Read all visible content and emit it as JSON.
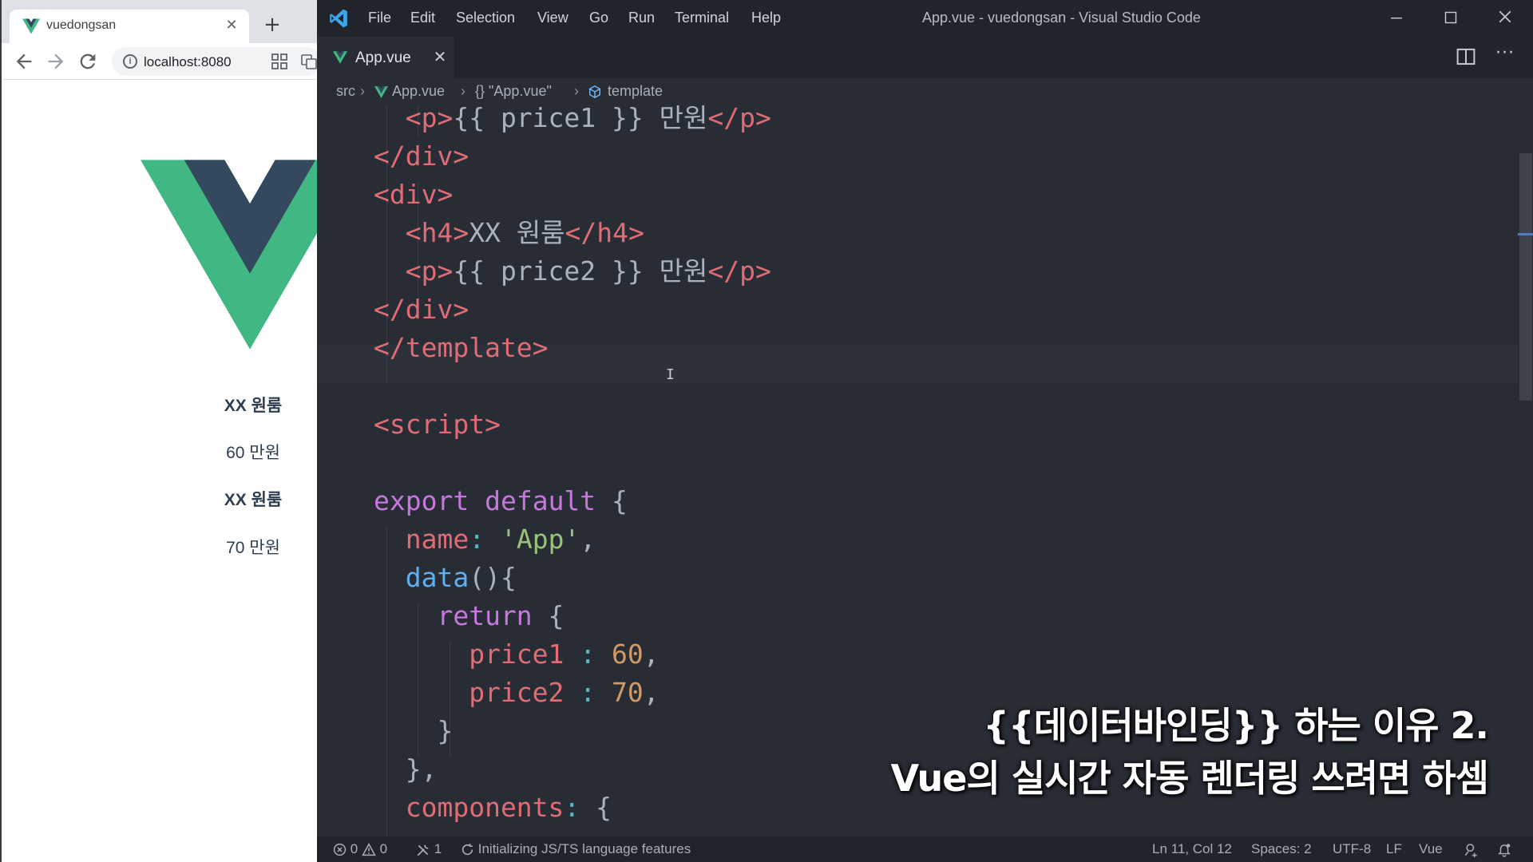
{
  "browser": {
    "tab_title": "vuedongsan",
    "tab_close": "✕",
    "new_tab": "+",
    "url": "localhost:8080",
    "page": {
      "products": [
        {
          "title": "XX 원룸",
          "price": "60 만원"
        },
        {
          "title": "XX 원룸",
          "price": "70 만원"
        }
      ]
    }
  },
  "vscode": {
    "menu": [
      "File",
      "Edit",
      "Selection",
      "View",
      "Go",
      "Run",
      "Terminal",
      "Help"
    ],
    "window_title": "App.vue - vuedongsan - Visual Studio Code",
    "tab": {
      "name": "App.vue",
      "close": "✕"
    },
    "breadcrumb": {
      "folder": "src",
      "file": "App.vue",
      "object": "{} \"App.vue\"",
      "symbol": "template"
    },
    "code_lines": [
      [
        {
          "t": "tag",
          "v": "  <p>"
        },
        {
          "t": "text",
          "v": "{{ price1 }} 만원"
        },
        {
          "t": "tag",
          "v": "</p>"
        }
      ],
      [
        {
          "t": "tag",
          "v": "</div>"
        }
      ],
      [
        {
          "t": "tag",
          "v": "<div>"
        }
      ],
      [
        {
          "t": "tag",
          "v": "  <h4>"
        },
        {
          "t": "text",
          "v": "XX 원룸"
        },
        {
          "t": "tag",
          "v": "</h4>"
        }
      ],
      [
        {
          "t": "tag",
          "v": "  <p>"
        },
        {
          "t": "text",
          "v": "{{ price2 }} 만원"
        },
        {
          "t": "tag",
          "v": "</p>"
        }
      ],
      [
        {
          "t": "tag",
          "v": "</div>"
        }
      ],
      [
        {
          "t": "tag",
          "v": "</template>"
        }
      ],
      [],
      [
        {
          "t": "tag",
          "v": "<script>"
        }
      ],
      [],
      [
        {
          "t": "kw",
          "v": "export"
        },
        {
          "t": "punc",
          "v": " "
        },
        {
          "t": "kw",
          "v": "default"
        },
        {
          "t": "punc",
          "v": " {"
        }
      ],
      [
        {
          "t": "prop",
          "v": "  name"
        },
        {
          "t": "op",
          "v": ":"
        },
        {
          "t": "punc",
          "v": " "
        },
        {
          "t": "str",
          "v": "'App'"
        },
        {
          "t": "punc",
          "v": ","
        }
      ],
      [
        {
          "t": "fn",
          "v": "  data"
        },
        {
          "t": "punc",
          "v": "(){"
        }
      ],
      [
        {
          "t": "kw",
          "v": "    return"
        },
        {
          "t": "punc",
          "v": " {"
        }
      ],
      [
        {
          "t": "prop",
          "v": "      price1"
        },
        {
          "t": "punc",
          "v": " "
        },
        {
          "t": "op",
          "v": ":"
        },
        {
          "t": "punc",
          "v": " "
        },
        {
          "t": "num",
          "v": "60"
        },
        {
          "t": "punc",
          "v": ","
        }
      ],
      [
        {
          "t": "prop",
          "v": "      price2"
        },
        {
          "t": "punc",
          "v": " "
        },
        {
          "t": "op",
          "v": ":"
        },
        {
          "t": "punc",
          "v": " "
        },
        {
          "t": "num",
          "v": "70"
        },
        {
          "t": "punc",
          "v": ","
        }
      ],
      [
        {
          "t": "punc",
          "v": "    }"
        }
      ],
      [
        {
          "t": "punc",
          "v": "  },"
        }
      ],
      [
        {
          "t": "prop",
          "v": "  components"
        },
        {
          "t": "op",
          "v": ":"
        },
        {
          "t": "punc",
          "v": " {"
        }
      ]
    ],
    "status": {
      "errors": "0",
      "warnings": "0",
      "ports": "1",
      "message": "Initializing JS/TS language features",
      "position": "Ln 11, Col 12",
      "spaces": "Spaces: 2",
      "encoding": "UTF-8",
      "eol": "LF",
      "language": "Vue"
    }
  },
  "subtitle": {
    "line1": "{{데이터바인딩}} 하는 이유 2.",
    "line2": "Vue의 실시간 자동 렌더링 쓰려면 하셈"
  },
  "colors": {
    "vue_green": "#41b883",
    "vue_dark": "#34495e",
    "editor_bg": "#282c34"
  }
}
